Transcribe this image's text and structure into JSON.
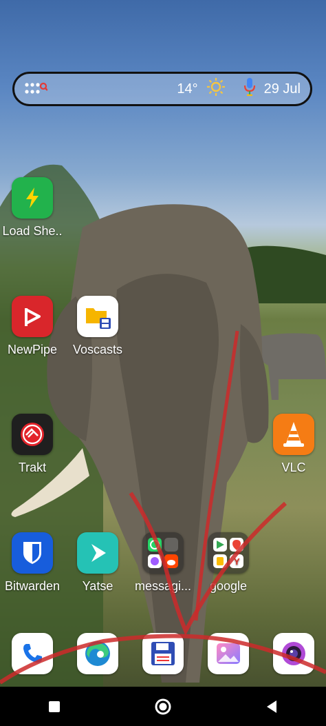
{
  "search_bar": {
    "temperature": "14°",
    "date": "29 Jul",
    "icons": [
      "app-drawer-search-icon",
      "sun-icon",
      "microphone-icon"
    ]
  },
  "apps": {
    "load_shedding": {
      "label": "Load She..",
      "color": "#22b24c"
    },
    "newpipe": {
      "label": "NewPipe",
      "color": "#d9262b"
    },
    "voscasts": {
      "label": "Voscasts",
      "color": "#ffffff"
    },
    "trakt": {
      "label": "Trakt",
      "color": "#1f1f1f"
    },
    "vlc": {
      "label": "VLC",
      "color": "#f57c14"
    },
    "bitwarden": {
      "label": "Bitwarden",
      "color": "#175ddc"
    },
    "yatse": {
      "label": "Yatse",
      "color": "#25c2b5"
    },
    "messaging_folder": {
      "label": "messagi..."
    },
    "google_folder": {
      "label": "google"
    }
  },
  "dock": [
    "phone-icon",
    "edge-browser-icon",
    "file-save-icon",
    "gallery-icon",
    "camera-icon"
  ],
  "navbar": [
    "recents-button",
    "home-button",
    "back-button"
  ],
  "colors": {
    "scribble": "#cc2a2a",
    "navbar": "#000000"
  }
}
